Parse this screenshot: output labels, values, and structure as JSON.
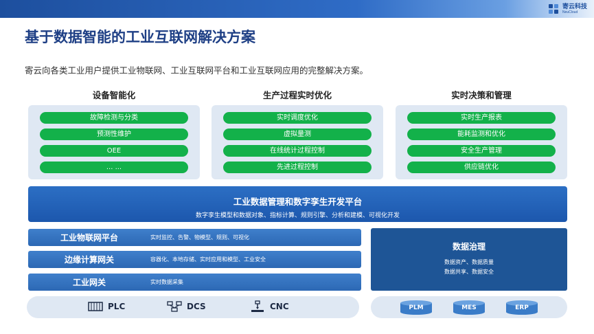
{
  "header": {
    "title": "基于数据智能的工业互联网解决方案",
    "subtitle": "寄云向各类工业用户提供工业物联网、工业互联网平台和工业互联网应用的完整解决方案。",
    "logo_name": "寄云科技",
    "logo_sub": "NeuCloud"
  },
  "columns": [
    {
      "title": "设备智能化",
      "items": [
        "故障检测与分类",
        "预测性维护",
        "OEE",
        "... ..."
      ]
    },
    {
      "title": "生产过程实时优化",
      "items": [
        "实时调度优化",
        "虚拟量测",
        "在线统计过程控制",
        "先进过程控制"
      ]
    },
    {
      "title": "实时决策和管理",
      "items": [
        "实时生产报表",
        "能耗监测和优化",
        "安全生产管理",
        "供应链优化"
      ]
    }
  ],
  "platform": {
    "title": "工业数据管理和数字孪生开发平台",
    "subtitle": "数字孪生模型和数据对象、指标计算、规则引擎、分析和建模、可视化开发"
  },
  "layers": [
    {
      "name": "工业物联网平台",
      "desc": "实时监控、告警、物模型、规则、可视化"
    },
    {
      "name": "边缘计算网关",
      "desc": "容器化、本地存储、实时应用和模型、工业安全"
    },
    {
      "name": "工业网关",
      "desc": "实时数据采集"
    }
  ],
  "governance": {
    "title": "数据治理",
    "line1": "数据资产、数据质量",
    "line2": "数据共享、数据安全"
  },
  "devices": [
    {
      "label": "PLC",
      "icon": "plc-chip-icon"
    },
    {
      "label": "DCS",
      "icon": "dcs-network-icon"
    },
    {
      "label": "CNC",
      "icon": "cnc-machine-icon"
    }
  ],
  "systems": [
    {
      "label": "PLM",
      "icon": "database-icon"
    },
    {
      "label": "MES",
      "icon": "database-icon"
    },
    {
      "label": "ERP",
      "icon": "database-icon"
    }
  ],
  "colors": {
    "title": "#1e3f85",
    "pill": "#13b14a",
    "platform": "#1c57ad",
    "bar": "#2c68b4",
    "governance": "#1e5596",
    "panel": "#dfe8f3",
    "db": "#3a7cc8"
  }
}
